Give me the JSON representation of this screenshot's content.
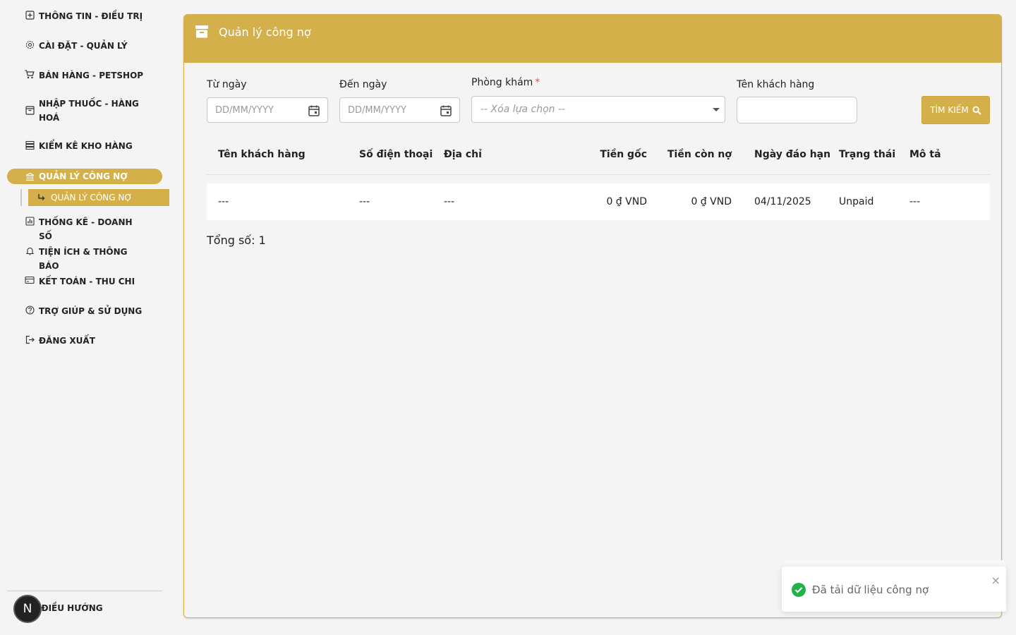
{
  "sidebar": {
    "items": [
      {
        "label": "THÔNG TIN - ĐIỀU TRỊ",
        "icon": "medical-box-icon"
      },
      {
        "label": "CÀI ĐẶT - QUẢN LÝ",
        "icon": "gear-icon"
      },
      {
        "label": "BÁN HÀNG - PETSHOP",
        "icon": "cart-icon"
      },
      {
        "label": "NHẬP THUỐC - HÀNG HOÁ",
        "icon": "archive-box-icon"
      },
      {
        "label": "KIỂM KÊ KHO HÀNG",
        "icon": "storage-icon"
      },
      {
        "label": "QUẢN LÝ CÔNG NỢ",
        "icon": "bank-icon"
      },
      {
        "label": "THỐNG KÊ - DOANH SỐ",
        "icon": "bar-chart-icon"
      },
      {
        "label": "TIỆN ÍCH & THÔNG BÁO",
        "icon": "bell-icon"
      },
      {
        "label": "KẾT TOÁN - THU CHI",
        "icon": "credit-card-icon"
      },
      {
        "label": "TRỢ GIÚP & SỬ DỤNG",
        "icon": "help-circle-icon"
      },
      {
        "label": "ĐĂNG XUẤT",
        "icon": "logout-icon"
      }
    ],
    "sub_item": {
      "label": "QUẢN LÝ CÔNG NỢ",
      "icon": "subdirectory-arrow-icon"
    },
    "collapse_label": "ẨN ĐIỀU HƯỚNG",
    "badge_letter": "N",
    "accent_color": "#d4b04a"
  },
  "card": {
    "title": "Quản lý công nợ",
    "icon": "archive-icon"
  },
  "filters": {
    "from_label": "Từ ngày",
    "from_placeholder": "DD/MM/YYYY",
    "to_label": "Đến ngày",
    "to_placeholder": "DD/MM/YYYY",
    "clinic_label": "Phòng khám",
    "clinic_required": "*",
    "clinic_value": "-- Xóa lựa chọn --",
    "customer_label": "Tên khách hàng",
    "customer_value": "",
    "search_label": "TÌM KIẾM"
  },
  "table": {
    "columns": [
      "Tên khách hàng",
      "Số điện thoại",
      "Địa chỉ",
      "Tiền gốc",
      "Tiền còn nợ",
      "Ngày đáo hạn",
      "Trạng thái",
      "Mô tả"
    ],
    "rows": [
      [
        "---",
        "---",
        "---",
        "0 ₫ VND",
        "0 ₫ VND",
        "04/11/2025",
        "Unpaid",
        "---"
      ]
    ],
    "total_label": "Tổng số: 1"
  },
  "toast": {
    "message": "Đã tải dữ liệu công nợ",
    "close": "×",
    "status_color": "#22b24c"
  }
}
